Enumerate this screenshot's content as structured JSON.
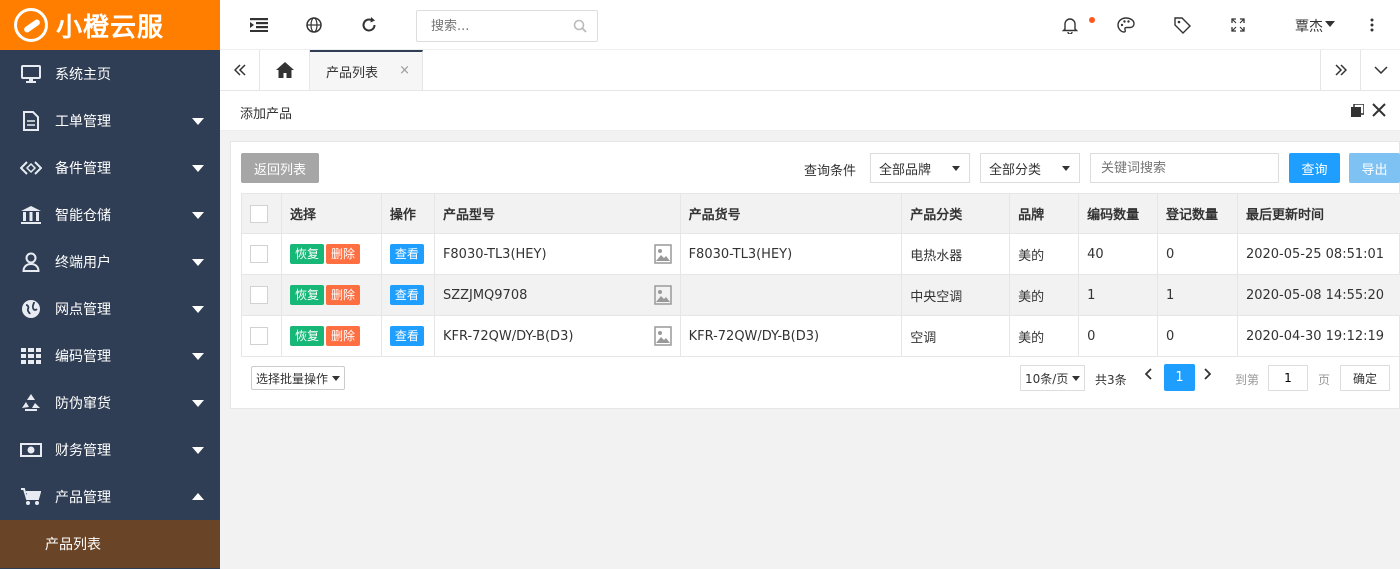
{
  "app": {
    "logo_text": "小橙云服",
    "brand_color": "#ff7e00",
    "sidebar_color": "#2f3e54"
  },
  "sidebar": {
    "items": [
      {
        "label": "系统主页",
        "icon": "monitor-icon"
      },
      {
        "label": "工单管理",
        "icon": "document-icon"
      },
      {
        "label": "备件管理",
        "icon": "parts-icon"
      },
      {
        "label": "智能仓储",
        "icon": "warehouse-icon"
      },
      {
        "label": "终端用户",
        "icon": "user-icon"
      },
      {
        "label": "网点管理",
        "icon": "globe-icon"
      },
      {
        "label": "编码管理",
        "icon": "grid-icon"
      },
      {
        "label": "防伪窜货",
        "icon": "recycle-icon"
      },
      {
        "label": "财务管理",
        "icon": "money-icon"
      },
      {
        "label": "产品管理",
        "icon": "cart-icon"
      }
    ],
    "sub_item": "产品列表"
  },
  "topbar": {
    "search_placeholder": "搜索...",
    "user": "覃杰"
  },
  "tabs": {
    "active": "产品列表",
    "close": "×"
  },
  "panel": {
    "title": "添加产品"
  },
  "toolbar": {
    "back_label": "返回列表",
    "filter_label": "查询条件",
    "brand_select": "全部品牌",
    "category_select": "全部分类",
    "keyword_placeholder": "关键词搜索",
    "query_label": "查询",
    "export_label": "导出"
  },
  "table": {
    "headers": [
      "选择",
      "操作",
      "产品型号",
      "产品货号",
      "产品分类",
      "品牌",
      "编码数量",
      "登记数量",
      "最后更新时间"
    ],
    "btn_restore": "恢复",
    "btn_delete": "删除",
    "btn_view": "查看",
    "rows": [
      {
        "model": "F8030-TL3(HEY)",
        "sku": "F8030-TL3(HEY)",
        "category": "电热水器",
        "brand": "美的",
        "code_qty": "40",
        "reg_qty": "0",
        "updated": "2020-05-25 08:51:01"
      },
      {
        "model": "SZZJMQ9708",
        "sku": "",
        "category": "中央空调",
        "brand": "美的",
        "code_qty": "1",
        "reg_qty": "1",
        "updated": "2020-05-08 14:55:20"
      },
      {
        "model": "KFR-72QW/DY-B(D3)",
        "sku": "KFR-72QW/DY-B(D3)",
        "category": "空调",
        "brand": "美的",
        "code_qty": "0",
        "reg_qty": "0",
        "updated": "2020-04-30 19:12:19"
      }
    ]
  },
  "footer": {
    "batch_select": "选择批量操作",
    "page_size": "10条/页",
    "total": "共3条",
    "current_page": "1",
    "goto_label": "到第",
    "goto_value": "1",
    "page_label": "页",
    "confirm_label": "确定"
  }
}
